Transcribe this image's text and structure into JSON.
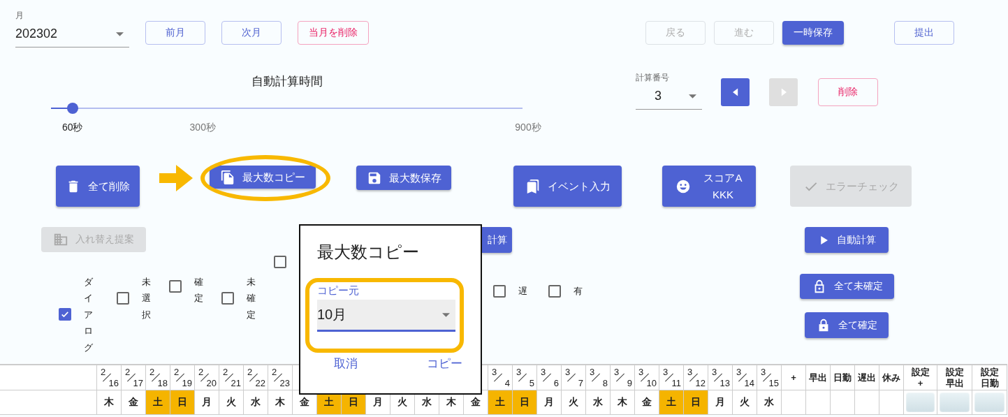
{
  "month_field": {
    "label": "月",
    "value": "202302"
  },
  "month_buttons": [
    {
      "label": "前月",
      "kind": "outlined"
    },
    {
      "label": "次月",
      "kind": "outlined"
    },
    {
      "label": "当月を削除",
      "kind": "danger"
    }
  ],
  "history_buttons": [
    {
      "label": "戻る",
      "disabled": true
    },
    {
      "label": "進む",
      "disabled": true
    }
  ],
  "save_button": {
    "label": "一時保存"
  },
  "submit_button": {
    "label": "提出"
  },
  "slider": {
    "title": "自動計算時間",
    "level": 0.056,
    "marks": [
      {
        "label": "60秒",
        "selected": true
      },
      {
        "label": "300秒",
        "selected": false
      },
      {
        "label": "900秒",
        "selected": false
      }
    ]
  },
  "calc_number": {
    "label": "計算番号",
    "value": "3"
  },
  "calc_nav": [
    {
      "kind": "prev",
      "disabled": false
    },
    {
      "kind": "next",
      "disabled": true
    }
  ],
  "delete_button": {
    "label": "削除"
  },
  "actions": [
    {
      "kind": "trash",
      "lines": [
        "全て削除"
      ],
      "disabled": false
    },
    {
      "kind": "copy",
      "lines": [
        "最大数コピー"
      ],
      "disabled": false
    },
    {
      "kind": "save",
      "lines": [
        "最大数保存"
      ],
      "disabled": false
    },
    {
      "kind": "event",
      "lines": [
        "イベント入力"
      ],
      "disabled": false
    },
    {
      "kind": "score",
      "lines": [
        "スコアA",
        "KKK"
      ],
      "disabled": false
    },
    {
      "kind": "check",
      "lines": [
        "エラーチェック"
      ],
      "disabled": true
    }
  ],
  "swap_button": {
    "label": "入れ替え提案",
    "disabled": true
  },
  "calc_button": {
    "label": "計算"
  },
  "auto_buttons": [
    {
      "label": "自動計算",
      "kind": "play"
    },
    {
      "label": "全て未確定",
      "kind": "unlock"
    },
    {
      "label": "全て確定",
      "kind": "lock"
    }
  ],
  "filters": [
    {
      "label": "ダイアログ",
      "checked": true
    },
    {
      "label": "未選択",
      "checked": false
    },
    {
      "label": "確定",
      "checked": false
    },
    {
      "label": "未確定",
      "checked": false
    },
    {
      "checked": false
    },
    {
      "label": "遅",
      "checked": false
    },
    {
      "label": "有",
      "checked": false
    }
  ],
  "dialog": {
    "title": "最大数コピー",
    "field_label": "コピー元",
    "value": "10月",
    "buttons": [
      "取消",
      "コピー"
    ]
  },
  "table": {
    "columns": [
      {
        "month": "2",
        "day": "16",
        "weekday": "木",
        "weekend": false
      },
      {
        "month": "2",
        "day": "17",
        "weekday": "金",
        "weekend": false
      },
      {
        "month": "2",
        "day": "18",
        "weekday": "土",
        "weekend": true
      },
      {
        "month": "2",
        "day": "19",
        "weekday": "日",
        "weekend": true
      },
      {
        "month": "2",
        "day": "20",
        "weekday": "月",
        "weekend": false
      },
      {
        "month": "2",
        "day": "21",
        "weekday": "火",
        "weekend": false
      },
      {
        "month": "2",
        "day": "22",
        "weekday": "水",
        "weekend": false
      },
      {
        "month": "2",
        "day": "23",
        "weekday": "木",
        "weekend": false
      },
      {
        "weekday": "金",
        "weekend": false
      },
      {
        "weekday": "土",
        "weekend": true
      },
      {
        "weekday": "日",
        "weekend": true
      },
      {
        "weekday": "月",
        "weekend": false
      },
      {
        "weekday": "火",
        "weekend": false
      },
      {
        "weekday": "水",
        "weekend": false
      },
      {
        "weekday": "木",
        "weekend": false
      },
      {
        "weekday": "金",
        "weekend": false
      },
      {
        "month": "3",
        "day": "4",
        "weekday": "土",
        "weekend": true
      },
      {
        "month": "3",
        "day": "5",
        "weekday": "日",
        "weekend": true
      },
      {
        "month": "3",
        "day": "6",
        "weekday": "月",
        "weekend": false
      },
      {
        "month": "3",
        "day": "7",
        "weekday": "火",
        "weekend": false
      },
      {
        "month": "3",
        "day": "8",
        "weekday": "水",
        "weekend": false
      },
      {
        "month": "3",
        "day": "9",
        "weekday": "木",
        "weekend": false
      },
      {
        "month": "3",
        "day": "10",
        "weekday": "金",
        "weekend": false
      },
      {
        "month": "3",
        "day": "11",
        "weekday": "土",
        "weekend": true
      },
      {
        "month": "3",
        "day": "12",
        "weekday": "日",
        "weekend": true
      },
      {
        "month": "3",
        "day": "13",
        "weekday": "月",
        "weekend": false
      },
      {
        "month": "3",
        "day": "14",
        "weekday": "火",
        "weekend": false
      },
      {
        "month": "3",
        "day": "15",
        "weekday": "水",
        "weekend": false
      }
    ],
    "summary_columns": [
      {
        "kind": "plain",
        "lines": [
          "+"
        ]
      },
      {
        "kind": "plain",
        "lines": [
          "早出"
        ]
      },
      {
        "kind": "plain",
        "lines": [
          "日勤"
        ]
      },
      {
        "kind": "plain",
        "lines": [
          "遅出"
        ]
      },
      {
        "kind": "plain",
        "lines": [
          "休み"
        ]
      },
      {
        "kind": "setting",
        "lines": [
          "設定",
          "+"
        ]
      },
      {
        "kind": "setting",
        "lines": [
          "設定",
          "早出"
        ]
      },
      {
        "kind": "setting",
        "lines": [
          "設定",
          "日勤"
        ]
      }
    ]
  }
}
